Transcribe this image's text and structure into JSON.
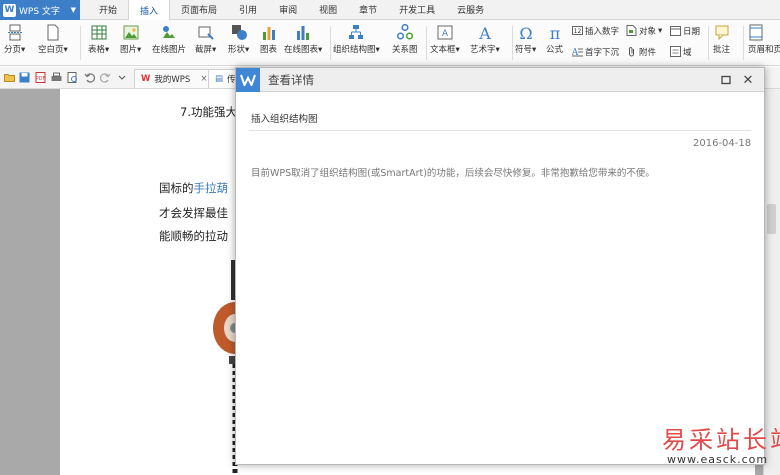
{
  "app": {
    "name": "WPS 文字"
  },
  "menu": {
    "tabs": [
      "开始",
      "插入",
      "页面布局",
      "引用",
      "审阅",
      "视图",
      "章节",
      "开发工具",
      "云服务"
    ],
    "active_index": 1
  },
  "ribbon": {
    "page_break": "分页",
    "blank_page": "空白页",
    "table": "表格",
    "picture": "图片",
    "online_picture": "在线图片",
    "screenshot": "截屏",
    "shape": "形状",
    "chart": "图表",
    "online_chart": "在线图表",
    "org_chart": "组织结构图",
    "relation_chart": "关系图",
    "text_box": "文本框",
    "word_art": "艺术字",
    "symbol": "符号",
    "formula": "公式",
    "insert_number": "插入数字",
    "object": "对象",
    "date": "日期",
    "drop_cap": "首字下沉",
    "attachment": "附件",
    "field": "域",
    "comment": "批注",
    "header_footer": "页眉和页"
  },
  "doc_tabs": {
    "my_wps": "我的WPS",
    "current": "传"
  },
  "document": {
    "line1": "7.功能强大",
    "line2_prefix": "国标的",
    "line2_link": "手拉葫",
    "line3": "才会发挥最佳",
    "line4": "能顺畅的拉动"
  },
  "dialog": {
    "title": "查看详情",
    "subject": "插入组织结构图",
    "date": "2016-04-18",
    "body": "目前WPS取消了组织结构图(或SmartArt)的功能，后续会尽快修复。非常抱歉给您带来的不便。"
  },
  "watermark": {
    "text": "易采站长站",
    "url": "www.easck.com"
  },
  "colors": {
    "accent": "#3c7fc8",
    "active_tab_text": "#1a5aa8",
    "link": "#3a7ac2",
    "watermark": "#e04a4a"
  }
}
